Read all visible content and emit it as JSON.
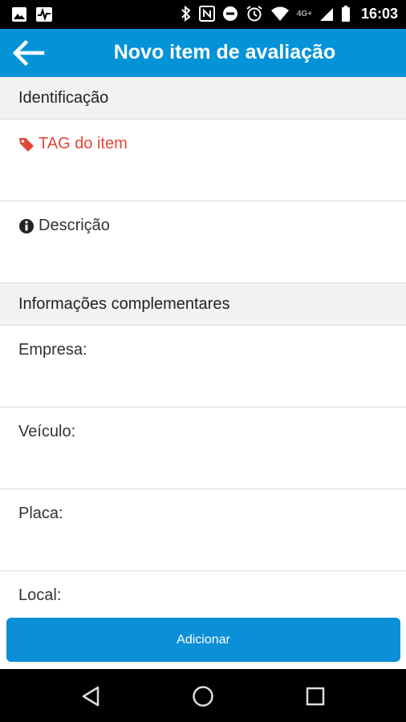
{
  "status_bar": {
    "time": "16:03",
    "network": "4G+",
    "icons": [
      "image-icon",
      "activity-icon",
      "bluetooth-icon",
      "nfc-icon",
      "do-not-disturb-icon",
      "alarm-icon",
      "wifi-icon",
      "signal-icon",
      "battery-icon"
    ]
  },
  "app_bar": {
    "title": "Novo item de avaliação",
    "back_icon": "arrow-left-icon"
  },
  "sections": {
    "identificacao": {
      "header": "Identificação",
      "tag_label": "TAG do item",
      "descricao_label": "Descrição"
    },
    "complementares": {
      "header": "Informações complementares",
      "empresa_label": "Empresa:",
      "veiculo_label": "Veículo:",
      "placa_label": "Placa:",
      "local_label": "Local:"
    }
  },
  "actions": {
    "add_label": "Adicionar"
  },
  "colors": {
    "primary": "#0593d7",
    "button": "#0b8fd6",
    "tag": "#e2473a",
    "section_bg": "#f2f2f2"
  },
  "nav_bar": {
    "icons": [
      "back-triangle-icon",
      "home-circle-icon",
      "recents-square-icon"
    ]
  }
}
